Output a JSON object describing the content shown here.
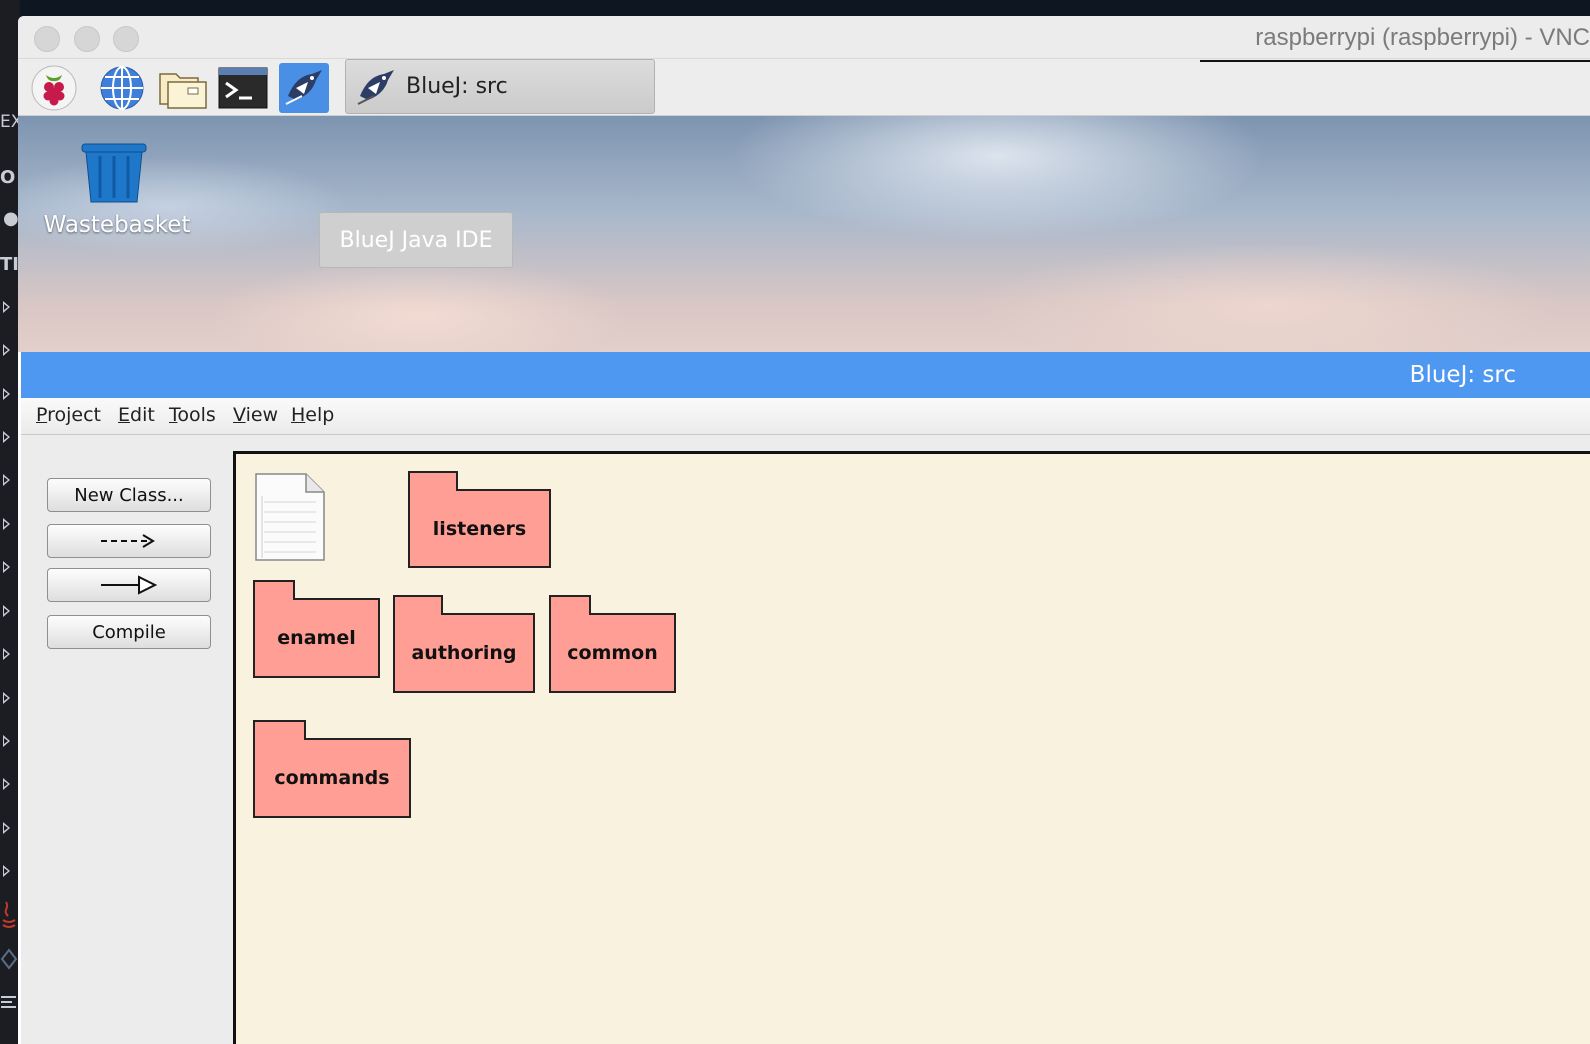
{
  "host": {
    "letters": [
      "EX",
      "O",
      "●",
      "TI"
    ]
  },
  "vnc": {
    "title": "raspberrypi (raspberrypi) - VNC"
  },
  "taskbar": {
    "icons": [
      "raspberry-icon",
      "globe-icon",
      "folder-icon",
      "terminal-icon",
      "bluej-icon"
    ],
    "task_label": "BlueJ:  src",
    "tooltip": "BlueJ Java IDE"
  },
  "desktop": {
    "trash_label": "Wastebasket"
  },
  "bluej": {
    "title": "BlueJ:  src",
    "menu": [
      {
        "mnemonic": "P",
        "rest": "roject"
      },
      {
        "mnemonic": "E",
        "rest": "dit"
      },
      {
        "mnemonic": "T",
        "rest": "ools"
      },
      {
        "mnemonic": "V",
        "rest": "iew"
      },
      {
        "mnemonic": "H",
        "rest": "elp"
      }
    ],
    "buttons": {
      "new_class": "New Class...",
      "dependency": "--->",
      "inheritance": "—▷",
      "compile": "Compile"
    },
    "packages": [
      "listeners",
      "enamel",
      "authoring",
      "common",
      "commands"
    ]
  },
  "colors": {
    "package_fill": "#ff9e94",
    "canvas": "#f9f2df",
    "titlebar": "#4f98f2"
  }
}
